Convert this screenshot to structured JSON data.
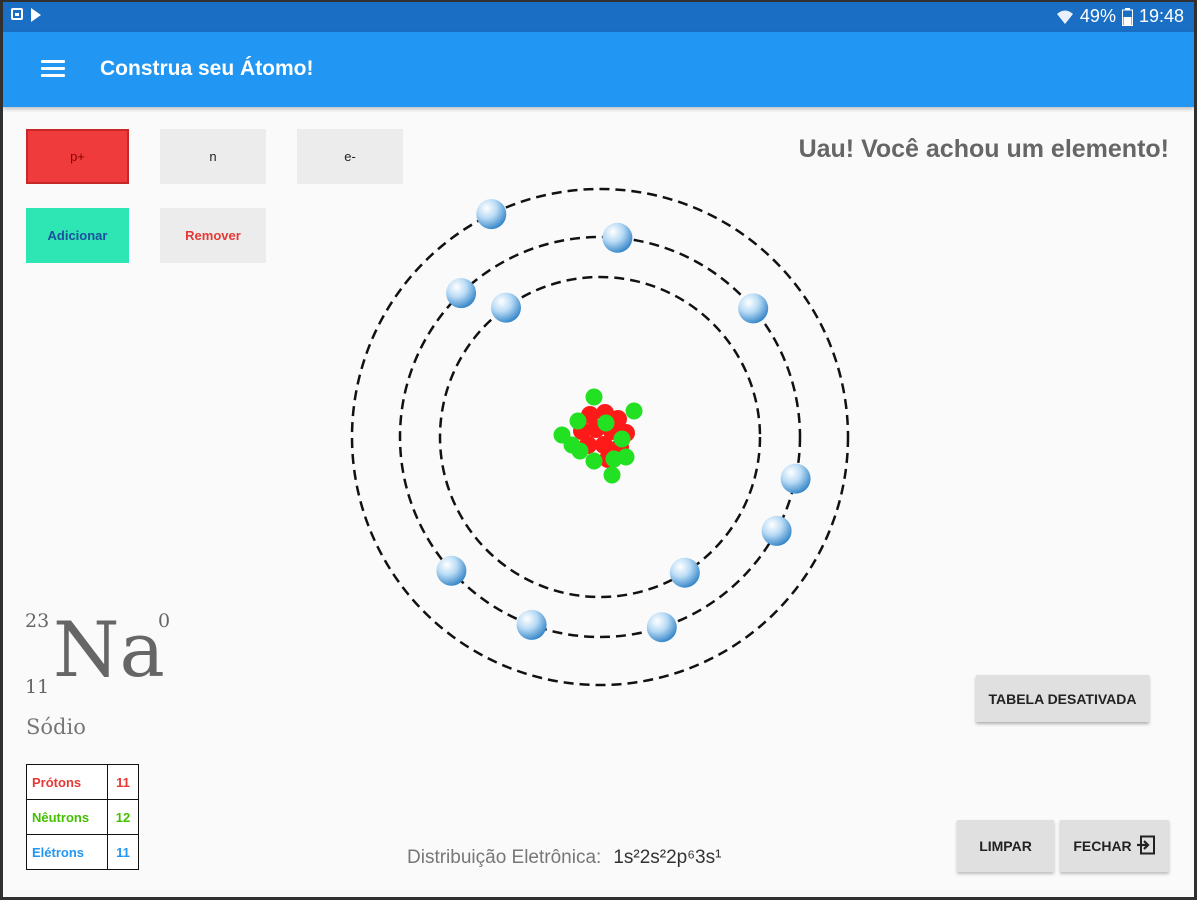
{
  "status_bar": {
    "battery": "49%",
    "time": "19:48",
    "icons": [
      "screenshot-icon",
      "play-icon",
      "wifi-icon",
      "battery-icon"
    ]
  },
  "app_bar": {
    "title": "Construa seu Átomo!",
    "menu_icon": "menu-icon"
  },
  "controls": {
    "proton": "p+",
    "neutron": "n",
    "electron": "e-",
    "add": "Adicionar",
    "remove": "Remover"
  },
  "message": "Uau! Você achou um elemento!",
  "element": {
    "mass_number": "23",
    "atomic_number": "11",
    "symbol": "Na",
    "charge": "0",
    "name": "Sódio"
  },
  "particles": [
    {
      "label": "Prótons",
      "value": "11",
      "color": "#e53935"
    },
    {
      "label": "Nêutrons",
      "value": "12",
      "color": "#43c000"
    },
    {
      "label": "Elétrons",
      "value": "11",
      "color": "#2196f3"
    }
  ],
  "atom_model": {
    "protons": 11,
    "neutrons": 12,
    "electrons_per_shell": [
      2,
      8,
      1
    ],
    "proton_color": "#ff1a1a",
    "neutron_color": "#22e022",
    "electron_color": "#7ab6e6"
  },
  "buttons": {
    "table": "TABELA DESATIVADA",
    "clear": "LIMPAR",
    "close": "FECHAR"
  },
  "distribution": {
    "label": "Distribuição Eletrônica:",
    "value": "1s²2s²2p⁶3s¹"
  },
  "colors": {
    "app_bar": "#2196f3",
    "status_bar": "#1a6fc4",
    "add_button": "#2de6b4",
    "proton_button": "#ef3b3b"
  }
}
